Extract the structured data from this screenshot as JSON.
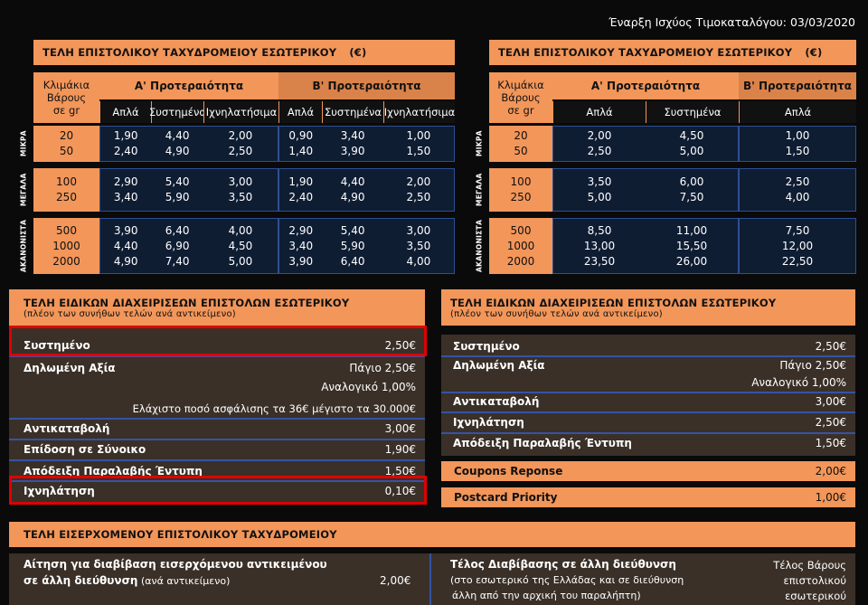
{
  "effective_date": "Έναρξη Ισχύος Τιμοκαταλόγου: 03/03/2020",
  "left_table": {
    "title": "ΤΕΛΗ ΕΠΙΣΤΟΛΙΚΟΥ ΤΑΧΥΔΡΟΜΕΙΟΥ ΕΣΩΤΕΡΙΚΟΥ",
    "currency": "(€)",
    "weight_header": [
      "Κλιμάκια",
      "Βάρους",
      "σε gr"
    ],
    "priority_a": "Α' Προτεραιότητα",
    "priority_b": "Β' Προτεραιότητα",
    "subheaders": [
      "Απλά",
      "Συστημένα",
      "Ιχνηλατήσιμα",
      "Απλά",
      "Συστημένα",
      "Ιχνηλατήσιμα"
    ],
    "groups": [
      {
        "label": "ΜΙΚΡΑ",
        "weights": [
          "20",
          "50"
        ],
        "cols": [
          [
            "1,90",
            "2,40"
          ],
          [
            "4,40",
            "4,90"
          ],
          [
            "2,00",
            "2,50"
          ],
          [
            "0,90",
            "1,40"
          ],
          [
            "3,40",
            "3,90"
          ],
          [
            "1,00",
            "1,50"
          ]
        ]
      },
      {
        "label": "ΜΕΓΑΛΑ",
        "weights": [
          "100",
          "250"
        ],
        "cols": [
          [
            "2,90",
            "3,40"
          ],
          [
            "5,40",
            "5,90"
          ],
          [
            "3,00",
            "3,50"
          ],
          [
            "1,90",
            "2,40"
          ],
          [
            "4,40",
            "4,90"
          ],
          [
            "2,00",
            "2,50"
          ]
        ]
      },
      {
        "label": "ΑΚΑΝΟΝΙΣΤΑ",
        "weights": [
          "500",
          "1000",
          "2000"
        ],
        "cols": [
          [
            "3,90",
            "4,40",
            "4,90"
          ],
          [
            "6,40",
            "6,90",
            "7,40"
          ],
          [
            "4,00",
            "4,50",
            "5,00"
          ],
          [
            "2,90",
            "3,40",
            "3,90"
          ],
          [
            "5,40",
            "5,90",
            "6,40"
          ],
          [
            "3,00",
            "3,50",
            "4,00"
          ]
        ]
      }
    ]
  },
  "right_table": {
    "title": "ΤΕΛΗ ΕΠΙΣΤΟΛΙΚΟΥ ΤΑΧΥΔΡΟΜΕΙΟΥ ΕΣΩΤΕΡΙΚΟΥ",
    "currency": "(€)",
    "weight_header": [
      "Κλιμάκια",
      "Βάρους",
      "σε gr"
    ],
    "priority_a": "Α' Προτεραιότητα",
    "priority_b": "Β' Προτεραιότητα",
    "subheaders": [
      "Απλά",
      "Συστημένα",
      "Απλά"
    ],
    "groups": [
      {
        "label": "ΜΙΚΡΑ",
        "weights": [
          "20",
          "50"
        ],
        "cols": [
          [
            "2,00",
            "2,50"
          ],
          [
            "4,50",
            "5,00"
          ],
          [
            "1,00",
            "1,50"
          ]
        ]
      },
      {
        "label": "ΜΕΓΑΛΑ",
        "weights": [
          "100",
          "250"
        ],
        "cols": [
          [
            "3,50",
            "5,00"
          ],
          [
            "6,00",
            "7,50"
          ],
          [
            "2,50",
            "4,00"
          ]
        ]
      },
      {
        "label": "ΑΚΑΝΟΝΙΣΤΑ",
        "weights": [
          "500",
          "1000",
          "2000"
        ],
        "cols": [
          [
            "8,50",
            "13,00",
            "23,50"
          ],
          [
            "11,00",
            "15,50",
            "26,00"
          ],
          [
            "7,50",
            "12,00",
            "22,50"
          ]
        ]
      }
    ]
  },
  "left_special": {
    "title": "ΤΕΛΗ ΕΙΔΙΚΩΝ ΔΙΑΧΕΙΡΙΣΕΩΝ ΕΠΙΣΤΟΛΩΝ ΕΣΩΤΕΡΙΚΟΥ",
    "subtitle": "(πλέον των συνήθων τελών ανά αντικείμενο)",
    "registered": {
      "label": "Συστημένο",
      "price": "2,50€"
    },
    "declared": {
      "label": "Δηλωμένη Αξία",
      "fixed": "Πάγιο 2,50€",
      "proportional": "Αναλογικό  1,00%",
      "note": "Ελάχιστο ποσό ασφάλισης τα 36€ μέγιστο τα 30.000€"
    },
    "cod": {
      "label": "Αντικαταβολή",
      "price": "3,00€"
    },
    "personal": {
      "label": "Επίδοση σε Σύνοικο",
      "price": "1,90€"
    },
    "receipt": {
      "label": "Απόδειξη Παραλαβής Έντυπη",
      "price": "1,50€"
    },
    "tracking": {
      "label": "Ιχνηλάτηση",
      "price": "0,10€"
    }
  },
  "right_special": {
    "title": "ΤΕΛΗ ΕΙΔΙΚΩΝ ΔΙΑΧΕΙΡΙΣΕΩΝ ΕΠΙΣΤΟΛΩΝ ΕΣΩΤΕΡΙΚΟΥ",
    "subtitle": "(πλέον των συνήθων τελών ανά αντικείμενο)",
    "registered": {
      "label": "Συστημένο",
      "price": "2,50€"
    },
    "declared": {
      "label": "Δηλωμένη Αξία",
      "fixed": "Πάγιο 2,50€",
      "proportional": "Αναλογικό  1,00%"
    },
    "cod": {
      "label": "Αντικαταβολή",
      "price": "3,00€"
    },
    "tracking": {
      "label": "Ιχνηλάτηση",
      "price": "2,50€"
    },
    "receipt": {
      "label": "Απόδειξη Παραλαβής Έντυπη",
      "price": "1,50€"
    },
    "coupons": {
      "label": "Coupons Reponse",
      "price": "2,00€"
    },
    "postcard": {
      "label": "Postcard  Priority",
      "price": "1,00€"
    }
  },
  "incoming": {
    "title": "ΤΕΛΗ ΕΙΣΕΡΧΟΜΕΝΟΥ ΕΠΙΣΤΟΛΙΚΟΥ ΤΑΧΥΔΡΟΜΕΙΟΥ",
    "left_line1": "Αίτηση για διαβίβαση εισερχόμενου αντικειμένου",
    "left_line2_bold": "σε άλλη διεύθυνση",
    "left_line2_rest": " (ανά αντικείμενο)",
    "left_price": "2,00€",
    "right_title": "Τέλος Διαβίβασης σε άλλη διεύθυνση",
    "right_line2": "(στο εσωτερικό της Ελλάδας και σε διεύθυνση",
    "right_line3": "άλλη από την αρχική του παραλήπτη)",
    "right_note": [
      "Τέλος Βάρους",
      "επιστολικού",
      "εσωτερικού"
    ]
  },
  "colors": {
    "orange": "#f2965a",
    "dark_orange": "#d9824a",
    "navy": "#0f1d33",
    "blue_border": "#2f4f94",
    "highlight": "#e00000"
  }
}
